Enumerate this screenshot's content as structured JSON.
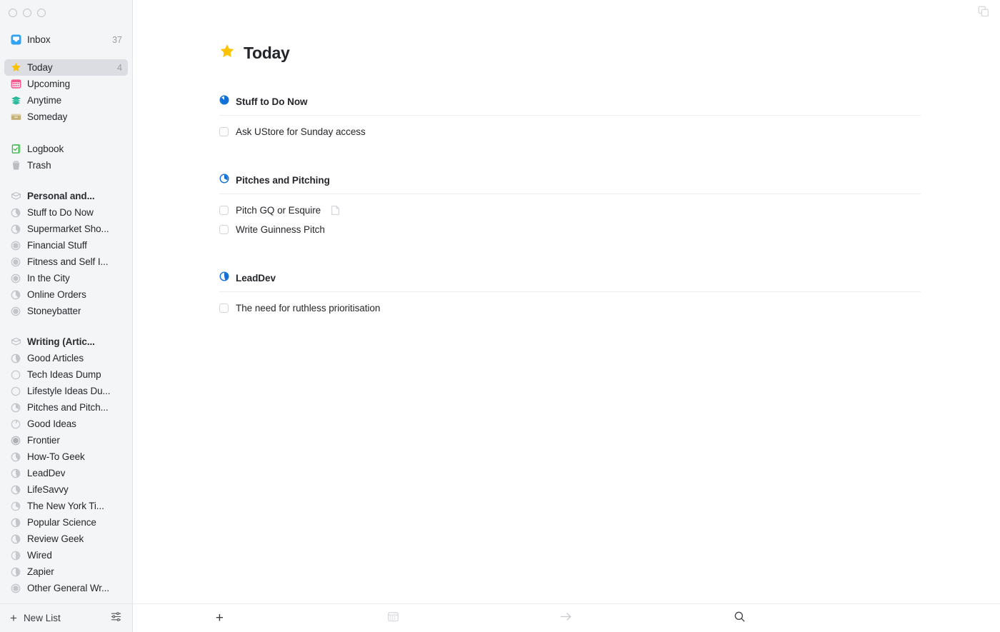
{
  "window": {
    "traffic_lights": [
      "close",
      "minimize",
      "zoom"
    ],
    "window_icon": "windows-copy-icon"
  },
  "sidebar": {
    "top_items": [
      {
        "label": "Inbox",
        "count": "37",
        "icon": "inbox-icon",
        "selected": false
      },
      {
        "label": "Today",
        "count": "4",
        "icon": "star-icon",
        "selected": true
      },
      {
        "label": "Upcoming",
        "count": "",
        "icon": "calendar-icon",
        "selected": false
      },
      {
        "label": "Anytime",
        "count": "",
        "icon": "layers-icon",
        "selected": false
      },
      {
        "label": "Someday",
        "count": "",
        "icon": "box-icon",
        "selected": false
      }
    ],
    "second_items": [
      {
        "label": "Logbook",
        "count": "",
        "icon": "logbook-icon",
        "selected": false
      },
      {
        "label": "Trash",
        "count": "",
        "icon": "trash-icon",
        "selected": false
      }
    ],
    "areas": [
      {
        "label": "Personal and...",
        "icon": "area-icon",
        "projects": [
          {
            "label": "Stuff to Do Now",
            "icon": "project-progress-icon",
            "progress": 0.72
          },
          {
            "label": "Supermarket Sho...",
            "icon": "project-progress-icon",
            "progress": 0.74
          },
          {
            "label": "Financial Stuff",
            "icon": "project-progress-icon",
            "progress": 0.95
          },
          {
            "label": "Fitness and Self I...",
            "icon": "project-progress-icon",
            "progress": 0.95
          },
          {
            "label": "In the City",
            "icon": "project-progress-icon",
            "progress": 0.92
          },
          {
            "label": "Online Orders",
            "icon": "project-progress-icon",
            "progress": 0.7
          },
          {
            "label": "Stoneybatter",
            "icon": "project-progress-icon",
            "progress": 0.95
          }
        ]
      },
      {
        "label": "Writing (Artic...",
        "icon": "area-icon",
        "projects": [
          {
            "label": "Good Articles",
            "icon": "project-progress-icon",
            "progress": 0.62
          },
          {
            "label": "Tech Ideas Dump",
            "icon": "project-progress-icon",
            "progress": 0.0
          },
          {
            "label": "Lifestyle Ideas Du...",
            "icon": "project-progress-icon",
            "progress": 0.0
          },
          {
            "label": "Pitches and Pitch...",
            "icon": "project-progress-icon",
            "progress": 0.3
          },
          {
            "label": "Good Ideas",
            "icon": "project-progress-icon",
            "progress": 0.08
          },
          {
            "label": "Frontier",
            "icon": "project-progress-icon",
            "progress": 1.0
          },
          {
            "label": "How-To Geek",
            "icon": "project-progress-icon",
            "progress": 0.68
          },
          {
            "label": "LeadDev",
            "icon": "project-progress-icon",
            "progress": 0.6
          },
          {
            "label": "LifeSavvy",
            "icon": "project-progress-icon",
            "progress": 0.68
          },
          {
            "label": "The New York Ti...",
            "icon": "project-progress-icon",
            "progress": 0.35
          },
          {
            "label": "Popular Science",
            "icon": "project-progress-icon",
            "progress": 0.78
          },
          {
            "label": "Review Geek",
            "icon": "project-progress-icon",
            "progress": 0.55
          },
          {
            "label": "Wired",
            "icon": "project-progress-icon",
            "progress": 0.45
          },
          {
            "label": "Zapier",
            "icon": "project-progress-icon",
            "progress": 0.8
          },
          {
            "label": "Other General Wr...",
            "icon": "project-progress-icon",
            "progress": 0.95
          }
        ]
      }
    ],
    "bottom": {
      "new_list_label": "New List",
      "new_list_icon": "plus-icon",
      "settings_icon": "sliders-icon"
    }
  },
  "main": {
    "title": "Today",
    "title_icon": "star-icon",
    "groups": [
      {
        "title": "Stuff to Do Now",
        "icon": "project-progress-icon",
        "progress": 0.75,
        "todos": [
          {
            "text": "Ask UStore for Sunday access",
            "checked": false,
            "has_note": false
          }
        ]
      },
      {
        "title": "Pitches and Pitching",
        "icon": "project-progress-icon",
        "progress": 0.28,
        "todos": [
          {
            "text": "Pitch GQ or Esquire",
            "checked": false,
            "has_note": true
          },
          {
            "text": "Write Guinness Pitch",
            "checked": false,
            "has_note": false
          }
        ]
      },
      {
        "title": "LeadDev",
        "icon": "project-progress-icon",
        "progress": 0.58,
        "todos": [
          {
            "text": "The need for ruthless prioritisation",
            "checked": false,
            "has_note": false
          }
        ]
      }
    ],
    "toolbar": [
      {
        "icon": "plus-icon",
        "name": "new-todo-button",
        "active": true
      },
      {
        "icon": "calendar-icon",
        "name": "schedule-button",
        "active": false
      },
      {
        "icon": "arrow-right-icon",
        "name": "move-button",
        "active": false
      },
      {
        "icon": "search-icon",
        "name": "search-button",
        "active": true
      }
    ]
  },
  "colors": {
    "accent_blue": "#1070d8",
    "star_yellow": "#fcc200",
    "inbox_blue": "#32a2f2",
    "upcoming_pink": "#f7578c",
    "anytime_teal": "#2cb79a",
    "someday_tan": "#c6b077",
    "logbook_green": "#3cb54a",
    "trash_gray": "#b9bbc0",
    "sidebar_bg": "#f4f5f7",
    "selected_bg": "#dcdde2"
  }
}
